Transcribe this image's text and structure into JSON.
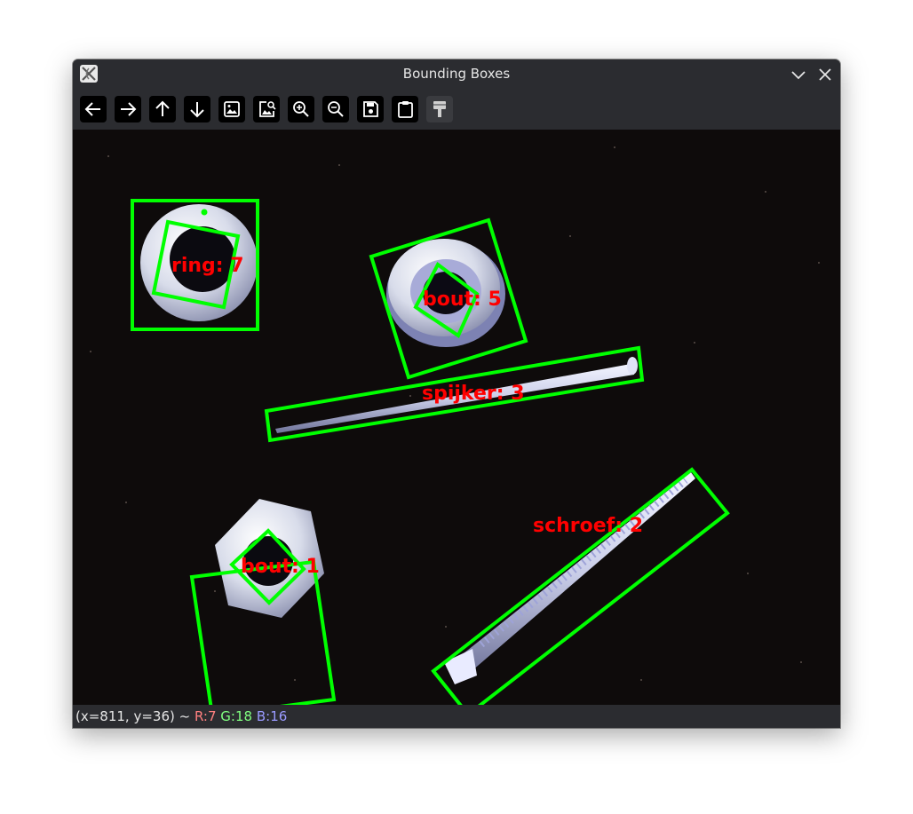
{
  "window": {
    "title": "Bounding Boxes",
    "app_icon": "x11-app-icon",
    "controls": [
      "minimize-chevron-icon",
      "close-icon"
    ]
  },
  "toolbar": {
    "buttons": [
      {
        "name": "pan-left",
        "icon": "arrow-left-icon",
        "enabled": true
      },
      {
        "name": "pan-right",
        "icon": "arrow-right-icon",
        "enabled": true
      },
      {
        "name": "pan-up",
        "icon": "arrow-up-icon",
        "enabled": true
      },
      {
        "name": "pan-down",
        "icon": "arrow-down-icon",
        "enabled": true
      },
      {
        "name": "fit-image",
        "icon": "image-icon",
        "enabled": true
      },
      {
        "name": "zoom-image",
        "icon": "image-search-icon",
        "enabled": true
      },
      {
        "name": "zoom-in",
        "icon": "zoom-in-icon",
        "enabled": true
      },
      {
        "name": "zoom-out",
        "icon": "zoom-out-icon",
        "enabled": true
      },
      {
        "name": "save",
        "icon": "save-icon",
        "enabled": true
      },
      {
        "name": "copy-to-clipboard",
        "icon": "clipboard-icon",
        "enabled": true
      },
      {
        "name": "properties",
        "icon": "paint-brush-icon",
        "enabled": false
      }
    ]
  },
  "image": {
    "background": "#0e0b0b",
    "box_color": "#00ff00",
    "label_color": "#ff0000",
    "detections": [
      {
        "label": "ring: 7"
      },
      {
        "label": "bout: 5"
      },
      {
        "label": "spijker: 3"
      },
      {
        "label": "schroef: 2"
      },
      {
        "label": "bout: 1"
      }
    ]
  },
  "status": {
    "coords": "(x=811, y=36) ~ ",
    "r": "R:7",
    "g": "G:18",
    "b": "B:16"
  }
}
